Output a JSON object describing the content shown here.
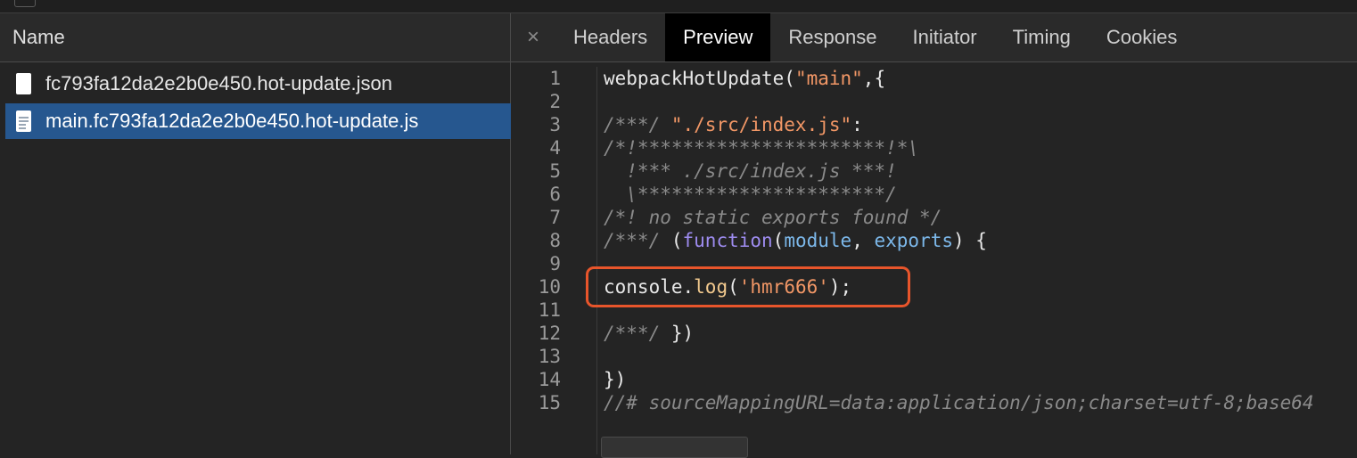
{
  "left_pane": {
    "header": "Name",
    "files": [
      {
        "name": "fc793fa12da2e2b0e450.hot-update.json",
        "icon": "json-file-icon",
        "selected": false
      },
      {
        "name": "main.fc793fa12da2e2b0e450.hot-update.js",
        "icon": "js-file-icon",
        "selected": true
      }
    ]
  },
  "tabs": {
    "close": "×",
    "items": [
      "Headers",
      "Preview",
      "Response",
      "Initiator",
      "Timing",
      "Cookies"
    ],
    "active": "Preview"
  },
  "code": {
    "line_numbers": [
      "1",
      "2",
      "3",
      "4",
      "5",
      "6",
      "7",
      "8",
      "9",
      "10",
      "11",
      "12",
      "13",
      "14",
      "15"
    ],
    "l1": {
      "a": "webpackHotUpdate(",
      "b": "\"main\"",
      "c": ",{"
    },
    "l3": {
      "a": "/***/ ",
      "b": "\"./src/index.js\"",
      "c": ":"
    },
    "l4": "/*!**********************!*\\",
    "l5": "  !*** ./src/index.js ***!",
    "l6": "  \\**********************/",
    "l7": "/*! no static exports found */",
    "l8": {
      "a": "/***/ ",
      "b": "(",
      "c": "function",
      "d": "(",
      "e": "module",
      "f": ", ",
      "g": "exports",
      "h": ") {"
    },
    "l10": {
      "a": "console.",
      "b": "log",
      "c": "(",
      "d": "'hmr666'",
      "e": ");"
    },
    "l12": {
      "a": "/***/ ",
      "b": "})"
    },
    "l14": "})",
    "l15": "//# sourceMappingURL=data:application/json;charset=utf-8;base64"
  },
  "colors": {
    "highlight_border": "#e8552b",
    "selected_row": "#26578f",
    "string": "#f29766",
    "comment": "#8a8a8a",
    "keyword": "#9e8cf0"
  }
}
